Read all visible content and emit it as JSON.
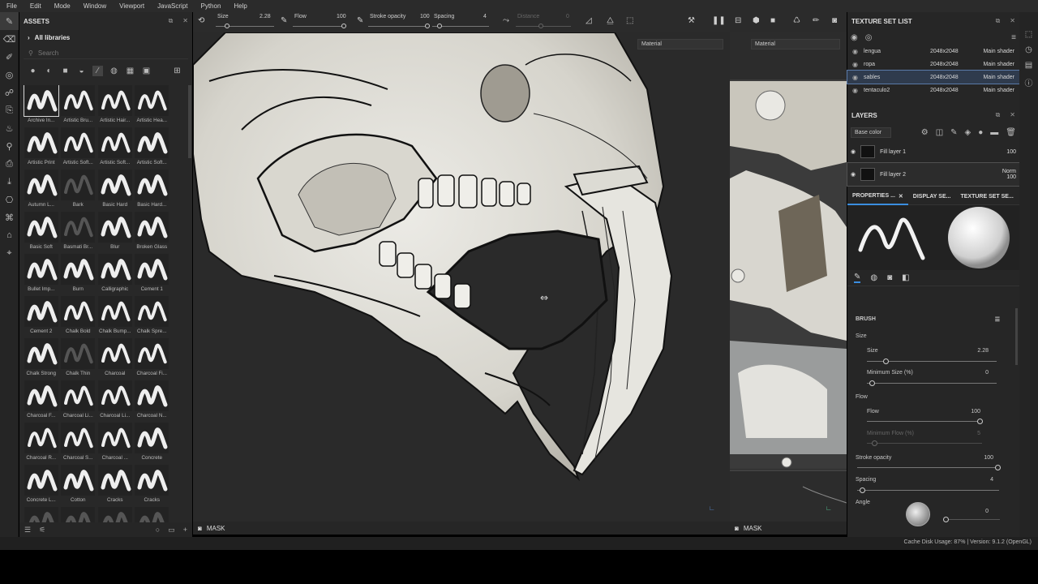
{
  "menu": [
    "File",
    "Edit",
    "Mode",
    "Window",
    "Viewport",
    "JavaScript",
    "Python",
    "Help"
  ],
  "assets": {
    "title": "ASSETS",
    "library": "All libraries",
    "search_placeholder": "Search",
    "brushes": [
      {
        "name": "Archive In...",
        "selected": true
      },
      {
        "name": "Artistic Bru..."
      },
      {
        "name": "Artistic Hair..."
      },
      {
        "name": "Artistic Hea..."
      },
      {
        "name": "Artistic Print"
      },
      {
        "name": "Artistic Soft..."
      },
      {
        "name": "Artistic Soft..."
      },
      {
        "name": "Artistic Soft..."
      },
      {
        "name": "Autumn L..."
      },
      {
        "name": "Bark"
      },
      {
        "name": "Basic Hard"
      },
      {
        "name": "Basic Hard..."
      },
      {
        "name": "Basic Soft"
      },
      {
        "name": "Basmati Br..."
      },
      {
        "name": "Blur"
      },
      {
        "name": "Broken Glass"
      },
      {
        "name": "Bullet Imp..."
      },
      {
        "name": "Burn"
      },
      {
        "name": "Calligraphic"
      },
      {
        "name": "Cement 1"
      },
      {
        "name": "Cement 2"
      },
      {
        "name": "Chalk Bold"
      },
      {
        "name": "Chalk Bump..."
      },
      {
        "name": "Chalk Spre..."
      },
      {
        "name": "Chalk Strong"
      },
      {
        "name": "Chalk Thin"
      },
      {
        "name": "Charcoal"
      },
      {
        "name": "Charcoal Fi..."
      },
      {
        "name": "Charcoal F..."
      },
      {
        "name": "Charcoal Li..."
      },
      {
        "name": "Charcoal Li..."
      },
      {
        "name": "Charcoal N..."
      },
      {
        "name": "Charcoal R..."
      },
      {
        "name": "Charcoal S..."
      },
      {
        "name": "Charcoal ..."
      },
      {
        "name": "Concrete"
      },
      {
        "name": "Concrete L..."
      },
      {
        "name": "Cotton"
      },
      {
        "name": "Cracks"
      },
      {
        "name": "Cracks"
      },
      {
        "name": ""
      },
      {
        "name": ""
      },
      {
        "name": ""
      },
      {
        "name": ""
      }
    ]
  },
  "toolbar": {
    "size_label": "Size",
    "size_value": "2.28",
    "flow_label": "Flow",
    "flow_value": "100",
    "opacity_label": "Stroke opacity",
    "opacity_value": "100",
    "spacing_label": "Spacing",
    "spacing_value": "4",
    "distance_label": "Distance",
    "distance_value": "0"
  },
  "viewport": {
    "material_3d": "Material",
    "material_2d": "Material",
    "mask_label": "MASK",
    "mask_label_2d": "MASK"
  },
  "texture_sets": {
    "title": "TEXTURE SET LIST",
    "rows": [
      {
        "name": "lengua",
        "res": "2048x2048",
        "shader": "Main shader"
      },
      {
        "name": "ropa",
        "res": "2048x2048",
        "shader": "Main shader"
      },
      {
        "name": "sables",
        "res": "2048x2048",
        "shader": "Main shader",
        "selected": true
      },
      {
        "name": "tentaculo2",
        "res": "2048x2048",
        "shader": "Main shader"
      }
    ]
  },
  "layers": {
    "title": "LAYERS",
    "channel": "Base color",
    "items": [
      {
        "name": "Fill layer 1",
        "blend": "",
        "opacity": "100"
      },
      {
        "name": "Fill layer 2",
        "blend": "Norm",
        "opacity": "100",
        "selected": true
      }
    ]
  },
  "properties": {
    "tabs": [
      "PROPERTIES ...",
      "DISPLAY SE...",
      "TEXTURE SET SE..."
    ],
    "brush_title": "BRUSH",
    "size_group": "Size",
    "size_label": "Size",
    "size_value": "2.28",
    "min_size_label": "Minimum Size (%)",
    "min_size_value": "0",
    "flow_group": "Flow",
    "flow_label": "Flow",
    "flow_value": "100",
    "min_flow_label": "Minimum Flow (%)",
    "min_flow_value": "5",
    "opacity_label": "Stroke opacity",
    "opacity_value": "100",
    "spacing_label": "Spacing",
    "spacing_value": "4",
    "angle_label": "Angle",
    "angle_value": "0"
  },
  "status": "Cache Disk Usage:  87% | Version: 9.1.2 (OpenGL)"
}
